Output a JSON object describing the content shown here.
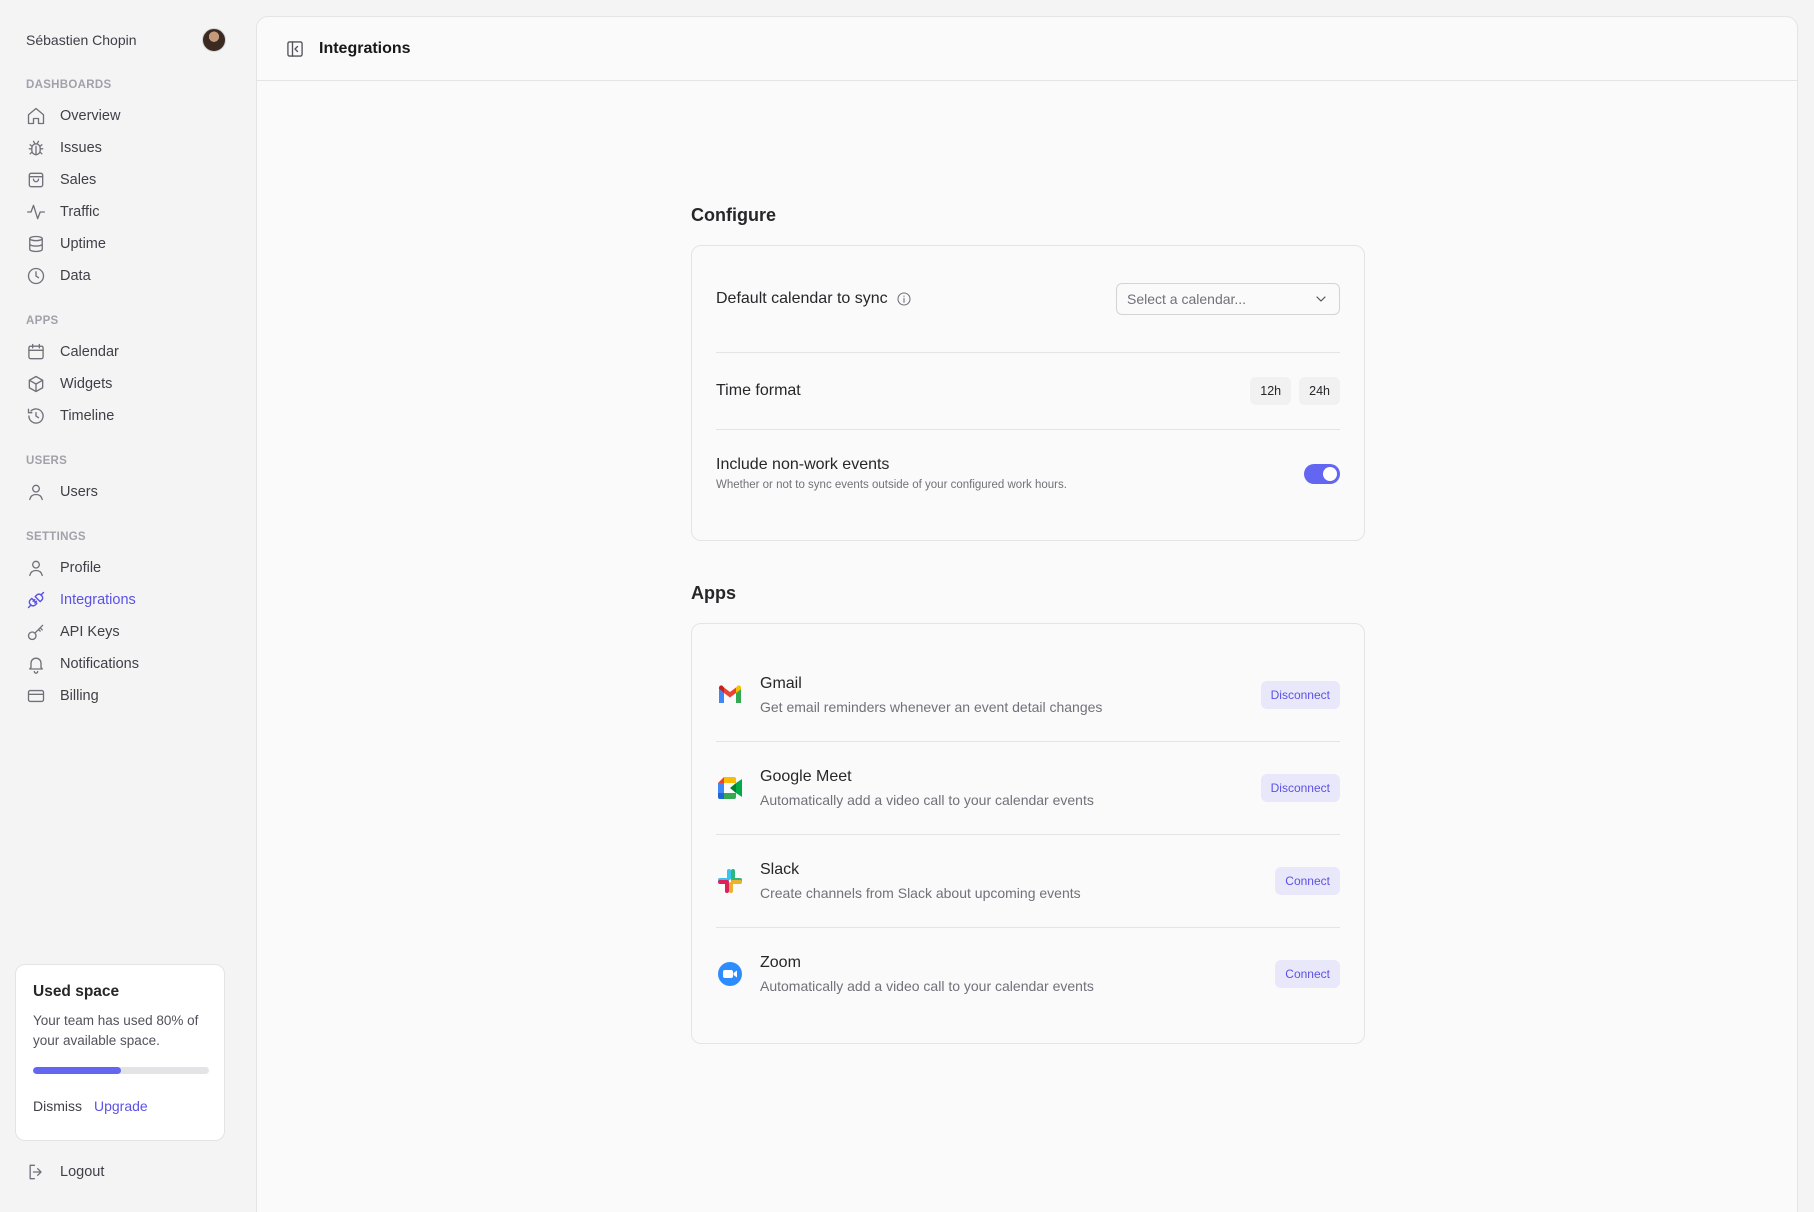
{
  "user": {
    "name": "Sébastien Chopin"
  },
  "sidebar": {
    "sections": {
      "dashboards": "Dashboards",
      "apps": "Apps",
      "users": "Users",
      "settings": "Settings"
    },
    "dashboards": [
      {
        "label": "Overview",
        "icon": "home-icon"
      },
      {
        "label": "Issues",
        "icon": "bug-icon"
      },
      {
        "label": "Sales",
        "icon": "shopping-bag-icon"
      },
      {
        "label": "Traffic",
        "icon": "activity-icon"
      },
      {
        "label": "Uptime",
        "icon": "database-icon"
      },
      {
        "label": "Data",
        "icon": "clock-icon"
      }
    ],
    "apps": [
      {
        "label": "Calendar",
        "icon": "calendar-icon"
      },
      {
        "label": "Widgets",
        "icon": "box-icon"
      },
      {
        "label": "Timeline",
        "icon": "history-icon"
      }
    ],
    "users": [
      {
        "label": "Users",
        "icon": "user-icon"
      }
    ],
    "settings": [
      {
        "label": "Profile",
        "icon": "user-icon"
      },
      {
        "label": "Integrations",
        "icon": "plug-icon",
        "active": true
      },
      {
        "label": "API Keys",
        "icon": "key-icon"
      },
      {
        "label": "Notifications",
        "icon": "bell-icon"
      },
      {
        "label": "Billing",
        "icon": "credit-card-icon"
      }
    ],
    "usage": {
      "title": "Used space",
      "description": "Your team has used 80% of your available space.",
      "progress": 0.5,
      "dismiss": "Dismiss",
      "upgrade": "Upgrade"
    },
    "logout": "Logout"
  },
  "header": {
    "title": "Integrations"
  },
  "configure": {
    "heading": "Configure",
    "calendar": {
      "label": "Default calendar to sync",
      "placeholder": "Select a calendar..."
    },
    "time_format": {
      "label": "Time format",
      "options": [
        "12h",
        "24h"
      ]
    },
    "non_work": {
      "label": "Include non-work events",
      "description": "Whether or not to sync events outside of your configured work hours.",
      "enabled": true
    }
  },
  "apps": {
    "heading": "Apps",
    "items": [
      {
        "name": "Gmail",
        "description": "Get email reminders whenever an event detail changes",
        "action": "Disconnect",
        "icon": "gmail-icon"
      },
      {
        "name": "Google Meet",
        "description": "Automatically add a video call to your calendar events",
        "action": "Disconnect",
        "icon": "google-meet-icon"
      },
      {
        "name": "Slack",
        "description": "Create channels from Slack about upcoming events",
        "action": "Connect",
        "icon": "slack-icon"
      },
      {
        "name": "Zoom",
        "description": "Automatically add a video call to your calendar events",
        "action": "Connect",
        "icon": "zoom-icon"
      }
    ]
  },
  "colors": {
    "accent": "#6366f1",
    "accent_text": "#5b52e5",
    "accent_soft": "#e9e8fb"
  }
}
